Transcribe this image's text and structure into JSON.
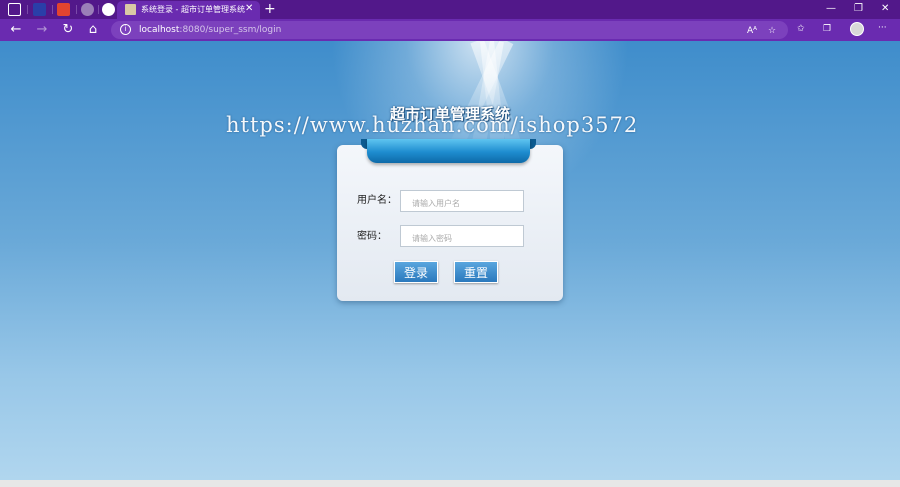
{
  "browser": {
    "active_tab_title": "系统登录 - 超市订单管理系统",
    "tab_close": "✕",
    "new_tab": "+",
    "address": {
      "host": "localhost",
      "rest": ":8080/super_ssm/login"
    },
    "read_aloud_label": "Aᴬ",
    "window_controls": {
      "minimize": "—",
      "maximize": "❐",
      "close": "✕"
    },
    "menu": "···"
  },
  "page": {
    "system_title": "超市订单管理系统",
    "watermark": "https://www.huzhan.com/ishop3572",
    "form": {
      "username_label": "用户名：",
      "username_placeholder": "请输入用户名",
      "password_label": "密码：",
      "password_placeholder": "请输入密码",
      "login_button": "登录",
      "reset_button": "重置"
    }
  },
  "colors": {
    "tabbar": "#52188a",
    "toolbar": "#6a2bb0",
    "ribbon": "#1e8ccf",
    "button": "#2b79bd"
  }
}
